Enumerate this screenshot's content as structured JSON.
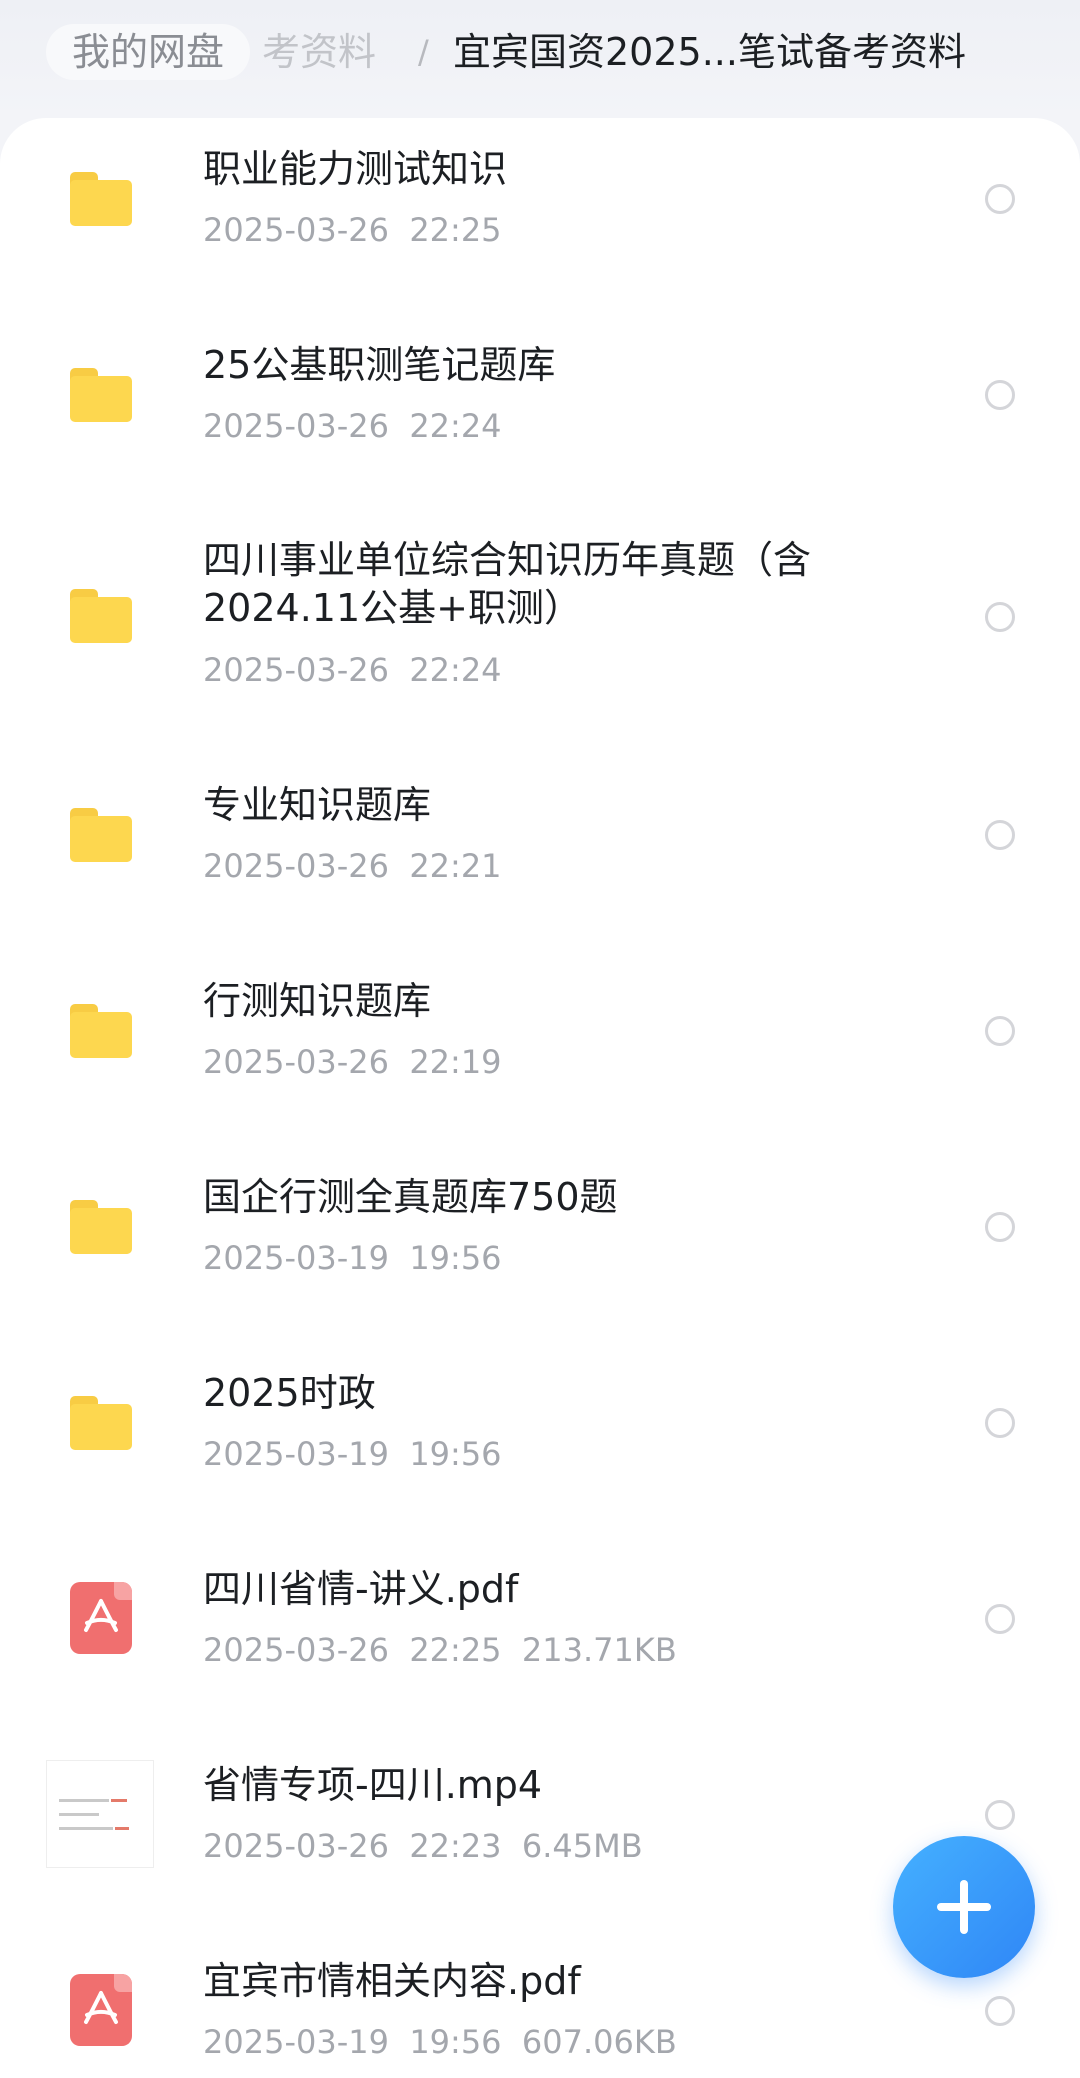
{
  "breadcrumb": {
    "root": "我的网盘",
    "parent": "考资料",
    "separator": "/",
    "current": "宜宾国资2025...笔试备考资料"
  },
  "files": [
    {
      "type": "folder",
      "icon": "folder-icon",
      "name": "职业能力测试知识",
      "meta": "2025-03-26  22:25"
    },
    {
      "type": "folder",
      "icon": "folder-icon",
      "name": "25公基职测笔记题库",
      "meta": "2025-03-26  22:24"
    },
    {
      "type": "folder",
      "icon": "folder-icon",
      "name": "四川事业单位综合知识历年真题（含2024.11公基+职测）",
      "meta": "2025-03-26  22:24"
    },
    {
      "type": "folder",
      "icon": "folder-icon",
      "name": "专业知识题库",
      "meta": "2025-03-26  22:21"
    },
    {
      "type": "folder",
      "icon": "folder-icon",
      "name": "行测知识题库",
      "meta": "2025-03-26  22:19"
    },
    {
      "type": "folder",
      "icon": "folder-icon",
      "name": "国企行测全真题库750题",
      "meta": "2025-03-19  19:56"
    },
    {
      "type": "folder",
      "icon": "folder-icon",
      "name": "2025时政",
      "meta": "2025-03-19  19:56"
    },
    {
      "type": "pdf",
      "icon": "pdf-icon",
      "name": "四川省情-讲义.pdf",
      "meta": "2025-03-26  22:25  213.71KB"
    },
    {
      "type": "video",
      "icon": "video-thumbnail",
      "name": "省情专项-四川.mp4",
      "meta": "2025-03-26  22:23  6.45MB"
    },
    {
      "type": "pdf",
      "icon": "pdf-icon",
      "name": "宜宾市情相关内容.pdf",
      "meta": "2025-03-19  19:56  607.06KB"
    }
  ],
  "fab": {
    "icon": "plus-icon"
  },
  "colors": {
    "folder": "#fdd74f",
    "pdf": "#f06f6f",
    "fab": "#3a9bfb",
    "secondary_text": "#a4a7ad"
  }
}
